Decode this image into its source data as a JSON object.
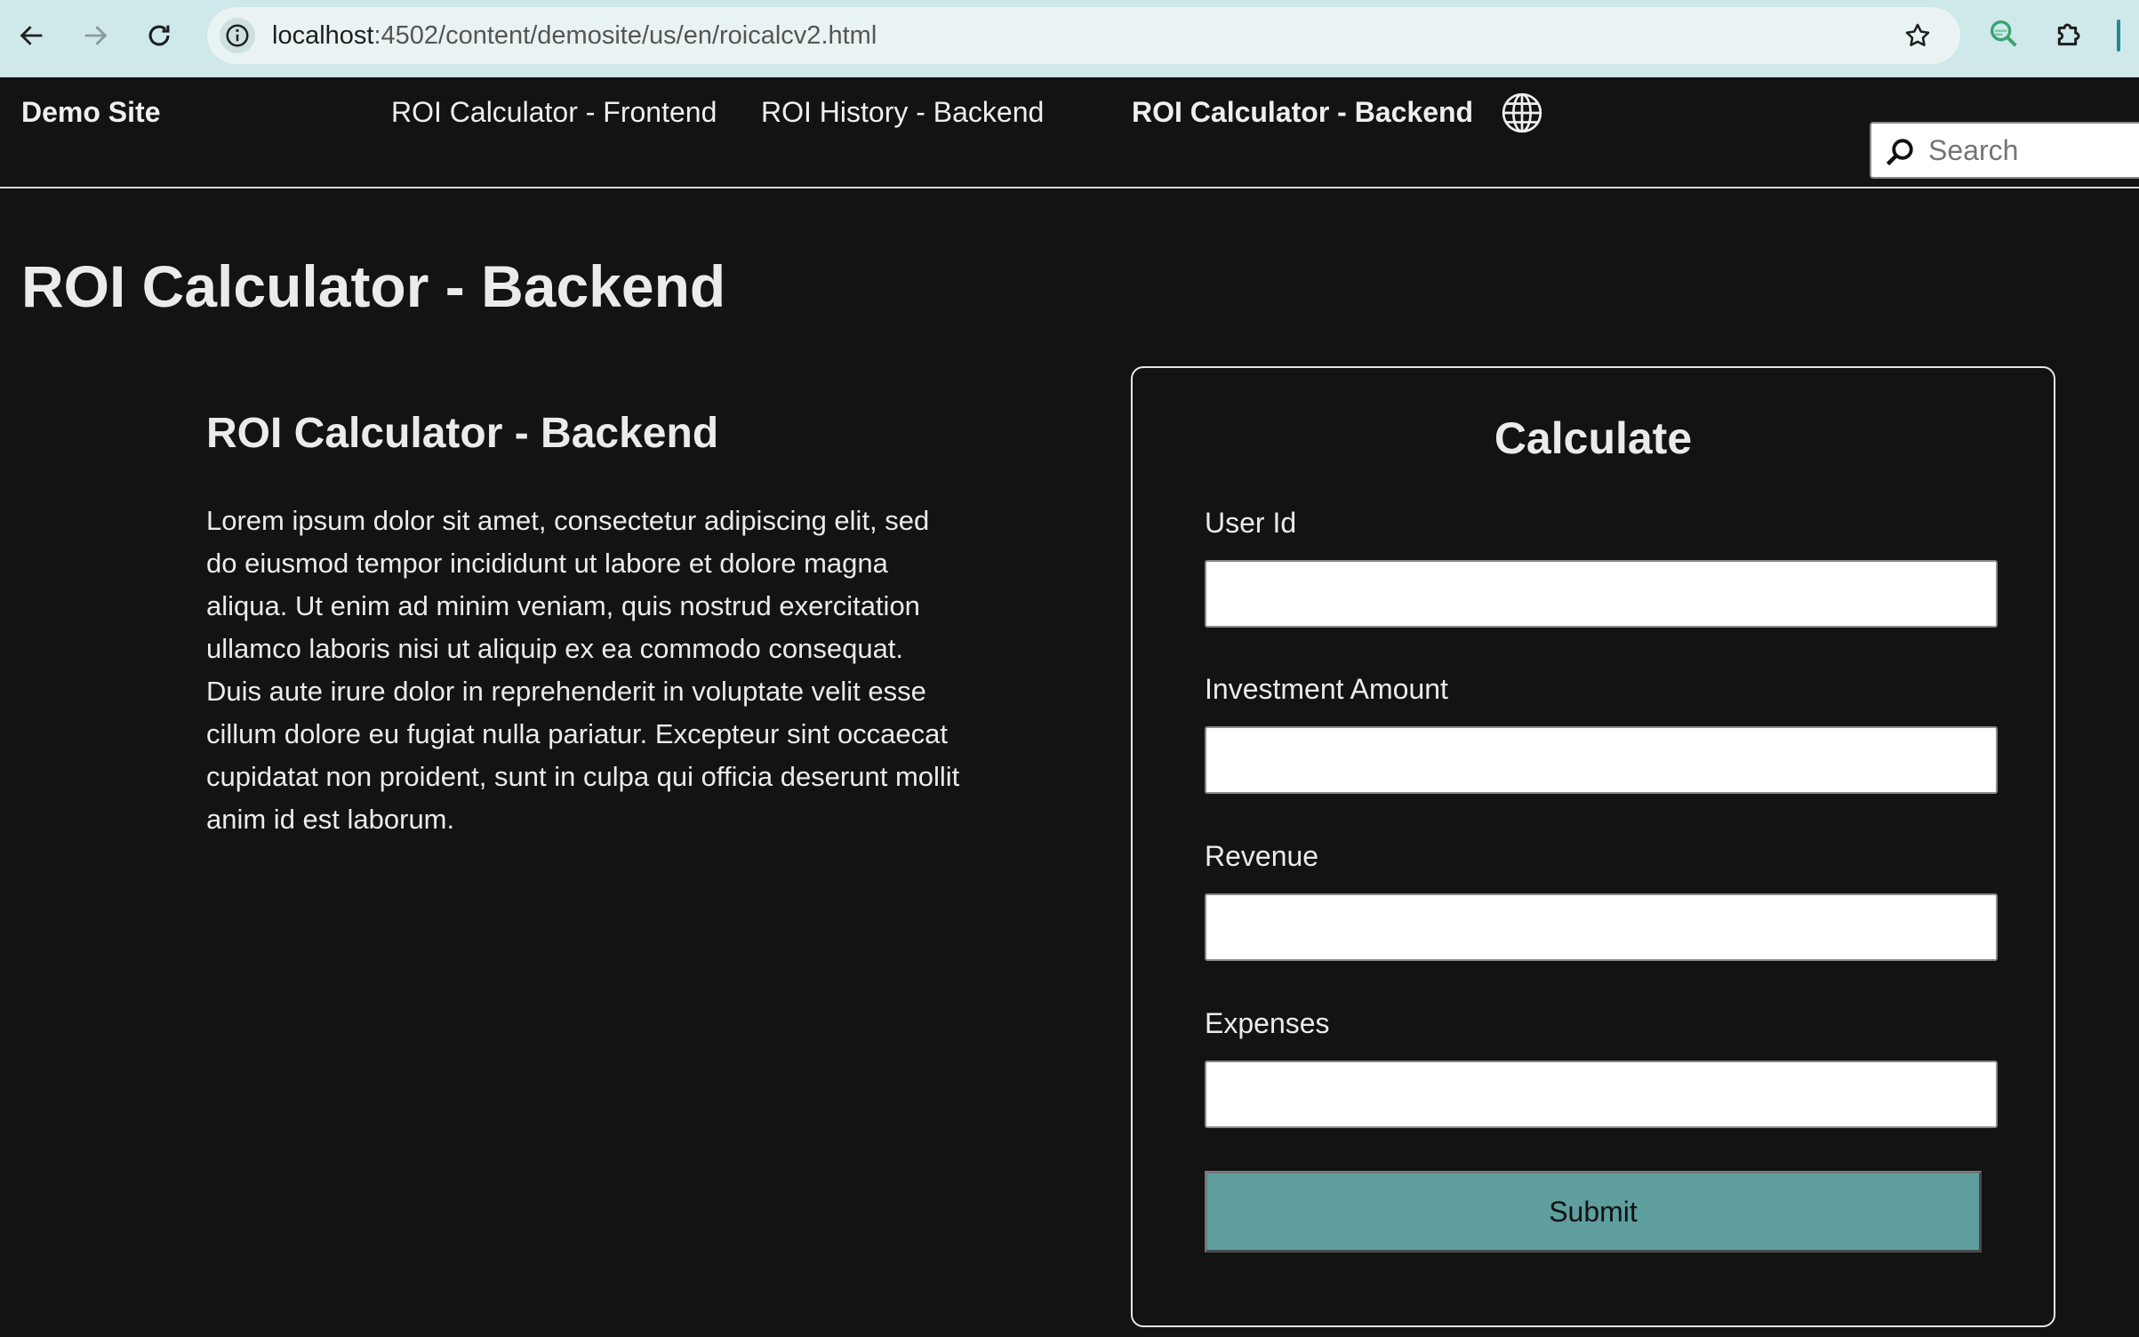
{
  "browser": {
    "url_host": "localhost",
    "url_path": ":4502/content/demosite/us/en/roicalcv2.html",
    "icons": {
      "back": "arrow-left-icon",
      "forward": "arrow-right-icon",
      "reload": "reload-icon",
      "site_info": "info-icon",
      "bookmark": "star-icon",
      "extension_search": "search-extension-icon",
      "extensions": "puzzle-icon"
    }
  },
  "header": {
    "brand": "Demo Site",
    "nav": [
      {
        "label": "ROI Calculator - Frontend",
        "active": false
      },
      {
        "label": "ROI History - Backend",
        "active": false
      },
      {
        "label": "ROI Calculator - Backend",
        "active": true
      }
    ],
    "language_icon": "globe-icon",
    "search": {
      "placeholder": "Search",
      "icon": "search-icon"
    }
  },
  "page": {
    "title": "ROI Calculator - Backend",
    "intro": {
      "title": "ROI Calculator - Backend",
      "body": "Lorem ipsum dolor sit amet, consectetur adipiscing elit, sed do eiusmod tempor incididunt ut labore et dolore magna aliqua. Ut enim ad minim veniam, quis nostrud exercitation ullamco laboris nisi ut aliquip ex ea commodo consequat. Duis aute irure dolor in reprehenderit in voluptate velit esse cillum dolore eu fugiat nulla pariatur. Excepteur sint occaecat cupidatat non proident, sunt in culpa qui officia deserunt mollit anim id est laborum."
    }
  },
  "form": {
    "title": "Calculate",
    "fields": [
      {
        "label": "User Id",
        "value": ""
      },
      {
        "label": "Investment Amount",
        "value": ""
      },
      {
        "label": "Revenue",
        "value": ""
      },
      {
        "label": "Expenses",
        "value": ""
      }
    ],
    "submit_label": "Submit"
  },
  "colors": {
    "page_background": "#131313",
    "browser_toolbar": "#cfe8ea",
    "submit_button": "#5e9e9f",
    "text": "#ebebeb"
  }
}
